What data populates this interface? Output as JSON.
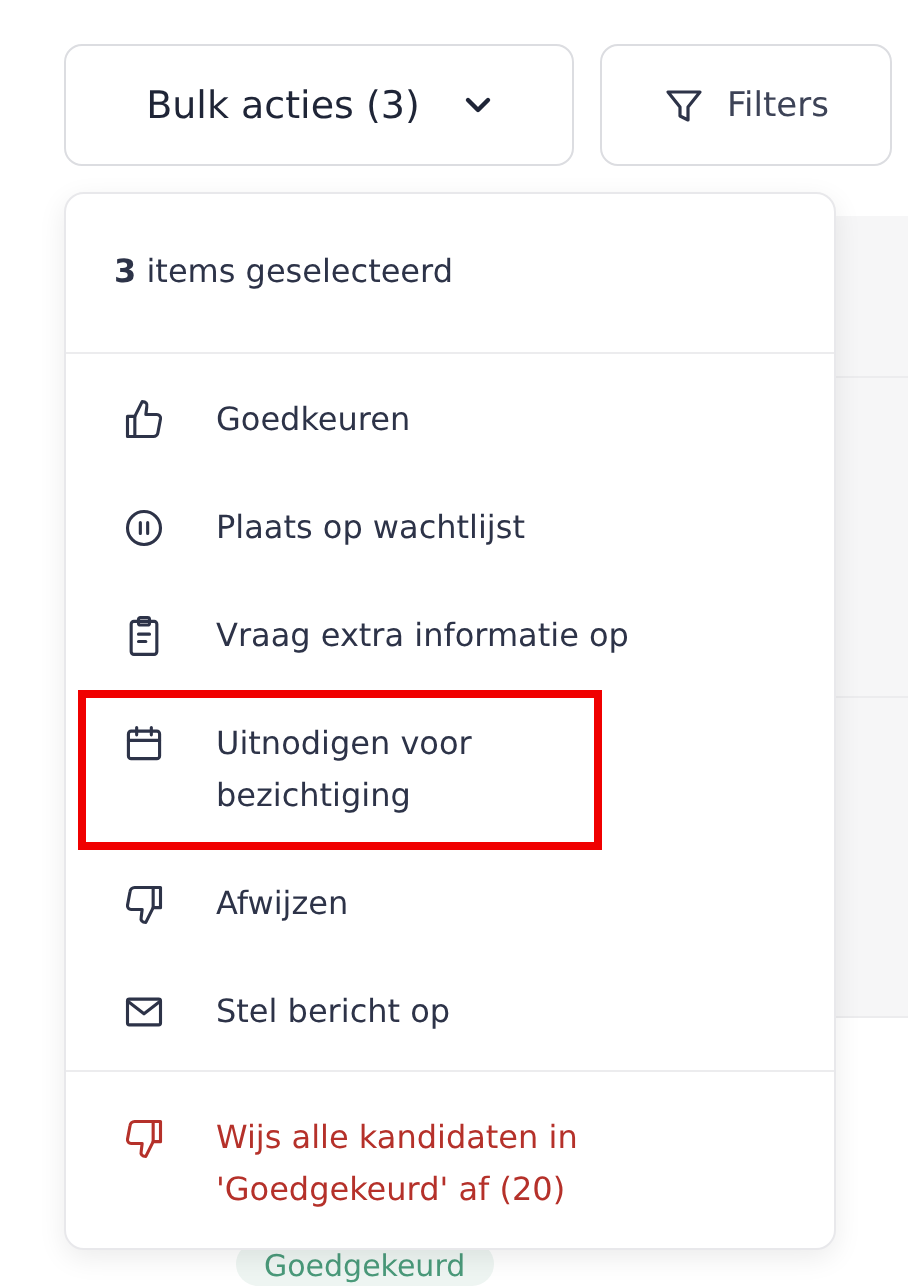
{
  "toolbar": {
    "bulk_button": "Bulk acties (3)",
    "filters_button": "Filters"
  },
  "background": {
    "tag": "Goedgekeurd"
  },
  "menu": {
    "header": "**3** items geselecteerd",
    "items": [
      {
        "kind": "action",
        "label": "Goedkeuren",
        "highlighted": false
      },
      {
        "kind": "action",
        "label": "Plaats op wachtlijst",
        "highlighted": false
      },
      {
        "kind": "action",
        "label": "Vraag extra informatie op",
        "highlighted": false
      },
      {
        "kind": "action",
        "label": "Uitnodigen voor bezichtiging",
        "highlighted": true
      },
      {
        "kind": "action",
        "label": "Afwijzen",
        "highlighted": false
      },
      {
        "kind": "action",
        "label": "Stel bericht op",
        "highlighted": false
      },
      {
        "kind": "danger",
        "label": "Wijs alle kandidaten in 'Goedgekeurd' af (20)",
        "highlighted": false
      }
    ]
  }
}
